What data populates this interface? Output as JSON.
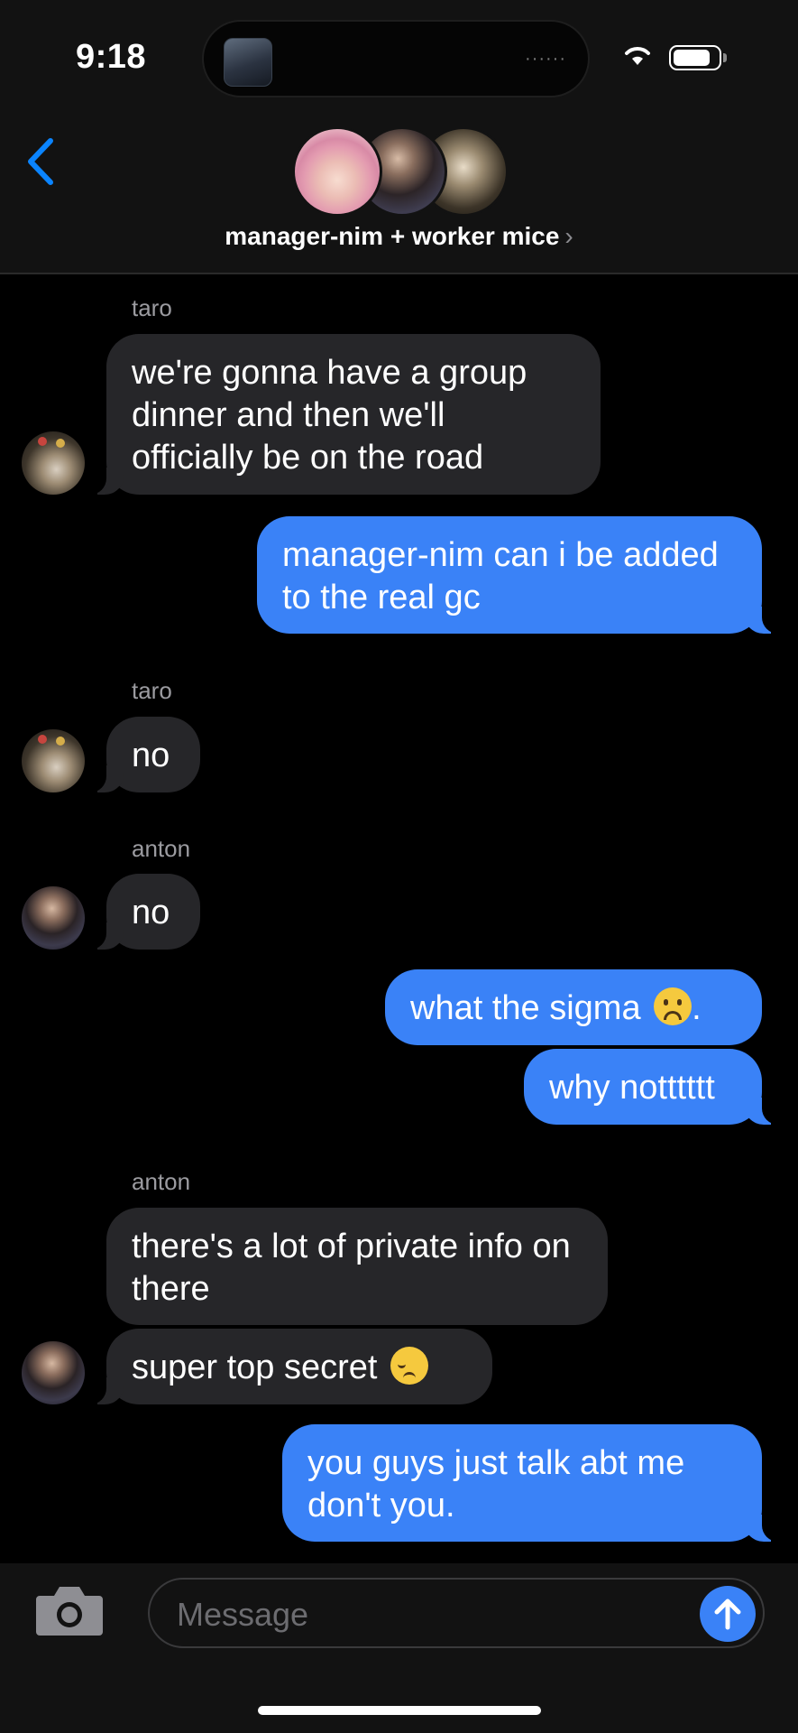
{
  "status_bar": {
    "time": "9:18",
    "island_indicator": "······"
  },
  "header": {
    "back_icon": "chevron-left-icon",
    "group_name": "manager-nim + worker mice",
    "chevron": "›"
  },
  "messages": [
    {
      "sender": "taro",
      "direction": "in",
      "text": "we're gonna have a group dinner and then we'll officially be on the road"
    },
    {
      "direction": "out",
      "text": "manager-nim can i be added to the real gc"
    },
    {
      "sender": "taro",
      "direction": "in",
      "text": "no"
    },
    {
      "sender": "anton",
      "direction": "in",
      "text": "no"
    },
    {
      "direction": "out",
      "text_before": "what the sigma ",
      "emoji": "frowning-face",
      "text_after": "."
    },
    {
      "direction": "out",
      "text": "why notttttt"
    },
    {
      "sender": "anton",
      "direction": "in",
      "text": "there's a lot of private info on there"
    },
    {
      "direction": "in",
      "text_before": "super top secret ",
      "emoji": "pensive-face"
    },
    {
      "direction": "out",
      "text": "you guys just talk abt me don't you."
    }
  ],
  "input": {
    "placeholder": "Message",
    "camera_icon": "camera-icon",
    "send_icon": "arrow-up-icon"
  },
  "colors": {
    "outgoing": "#3a82f7",
    "incoming": "#262629",
    "accent": "#0a84ff",
    "background": "#000000"
  }
}
